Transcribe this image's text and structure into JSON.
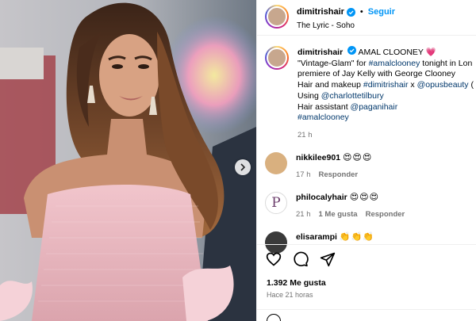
{
  "post": {
    "username": "dimitrishair",
    "follow_label": "Seguir",
    "location": "The Lyric - Soho",
    "more_label": "···"
  },
  "caption": {
    "username": "dimitrishair",
    "title": "AMAL CLOONEY",
    "title_emoji": "💗",
    "line1_prefix": "\"Vintage-Glam\" for ",
    "line1_tag": "#amalclooney",
    "line1_suffix": " tonight in Lon",
    "line2": "premiere of Jay Kelly with George Clooney",
    "line3_prefix": "Hair and makeup ",
    "line3_tag1": "#dimitrishair",
    "line3_mid": " x ",
    "line3_tag2": "@opusbeauty",
    "line3_suffix": " (",
    "line4_prefix": "Using ",
    "line4_tag": "@charlottetilbury",
    "line5_prefix": "Hair assistant ",
    "line5_tag": "@paganihair",
    "line6_tag": "#amalclooney",
    "time": "21 h"
  },
  "comments": [
    {
      "username": "nikkilee901",
      "text": "😍😍😍",
      "time": "17 h",
      "likes": "",
      "reply": "Responder"
    },
    {
      "username": "philocalyhair",
      "text": "😍😍😍",
      "time": "21 h",
      "likes": "1 Me gusta",
      "reply": "Responder"
    },
    {
      "username": "elisarampi",
      "text": "👏👏👏",
      "time": "",
      "likes": "",
      "reply": ""
    }
  ],
  "stats": {
    "likes": "1.392 Me gusta",
    "ago": "Hace 21 horas"
  },
  "icons": {
    "like": "heart-icon",
    "comment": "comment-icon",
    "share": "share-icon",
    "verified": "verified-badge-icon",
    "carousel_next": "chevron-right-icon"
  },
  "colors": {
    "link_blue": "#0095f6",
    "tag_color": "#00376b",
    "verified_blue": "#0095f6",
    "meta_gray": "#737373"
  }
}
